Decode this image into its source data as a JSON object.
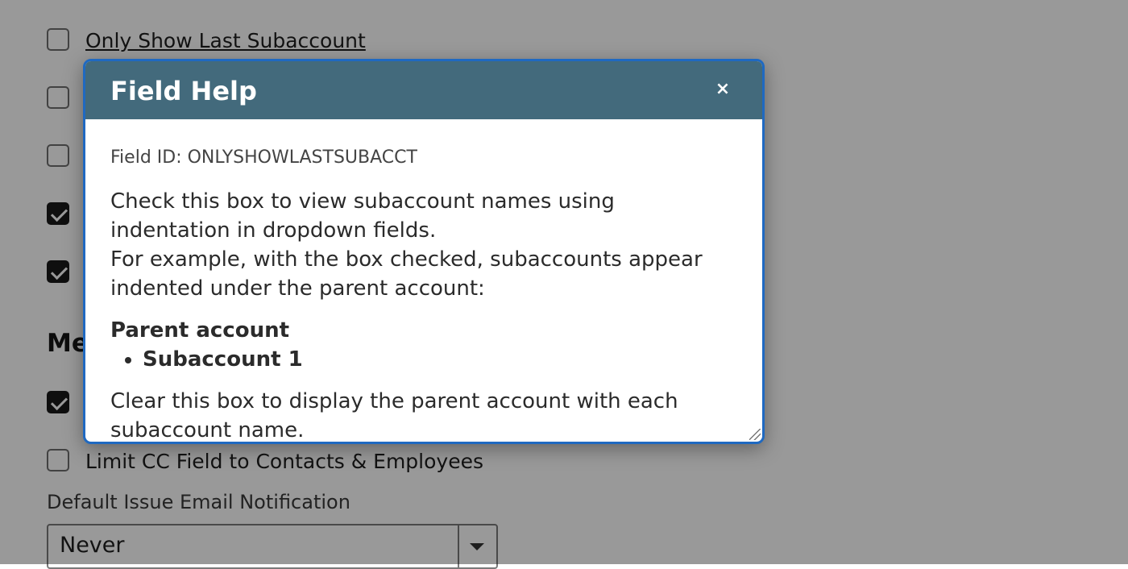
{
  "background": {
    "checkboxes": [
      {
        "label": "Only Show Last Subaccount",
        "checked": false,
        "link": true
      },
      {
        "label": "",
        "checked": false
      },
      {
        "label": "",
        "checked": false
      },
      {
        "label": "",
        "checked": true
      },
      {
        "label": "",
        "checked": true
      },
      {
        "label": "",
        "checked": true
      },
      {
        "label": "Limit CC Field to Contacts & Employees",
        "checked": false
      }
    ],
    "section_heading": "Me",
    "field_label": "Default Issue Email Notification",
    "select_value": "Never"
  },
  "dialog": {
    "title": "Field Help",
    "close_glyph": "×",
    "field_id": "Field ID: ONLYSHOWLASTSUBACCT",
    "paragraph1_line1": "Check this box to view subaccount names using indentation in dropdown fields.",
    "paragraph1_line2": "For example, with the box checked, subaccounts appear indented under the parent account:",
    "example_parent": "Parent account",
    "example_child": "Subaccount 1",
    "paragraph2": "Clear this box to display the parent account with each subaccount name."
  },
  "colors": {
    "dialog_header": "#436a7c",
    "dialog_border": "#1f69c1",
    "overlay": "rgba(0,0,0,0.40)"
  }
}
